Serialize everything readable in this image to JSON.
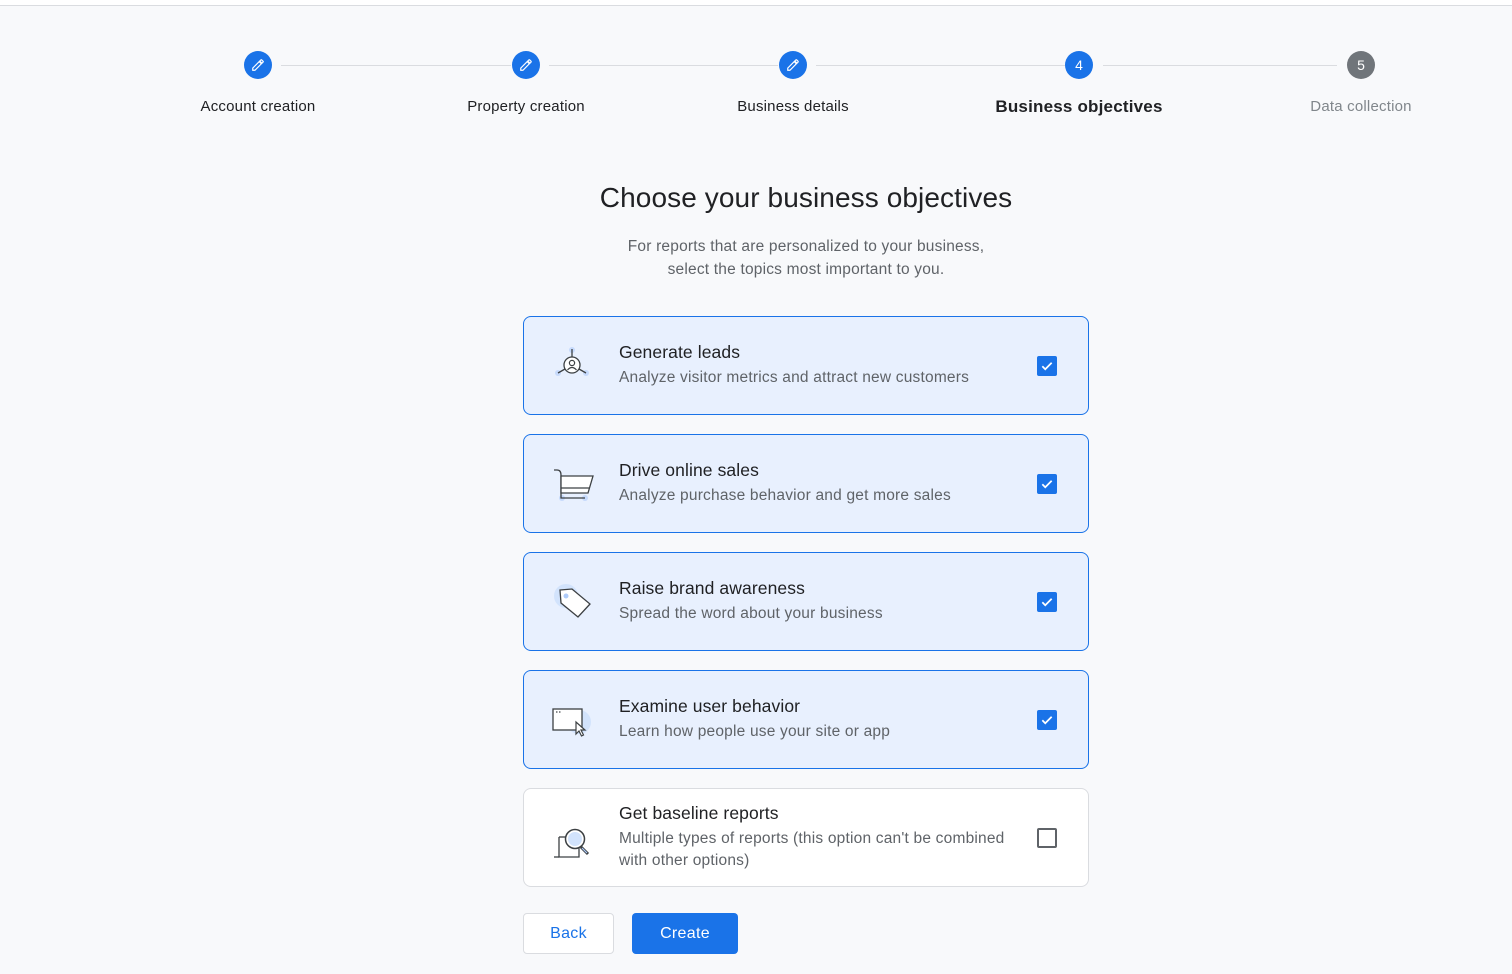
{
  "stepper": {
    "steps": [
      {
        "label": "Account creation",
        "state": "done",
        "icon": "pencil-icon"
      },
      {
        "label": "Property creation",
        "state": "done",
        "icon": "pencil-icon"
      },
      {
        "label": "Business details",
        "state": "done",
        "icon": "pencil-icon"
      },
      {
        "label": "Business objectives",
        "state": "active",
        "number": "4"
      },
      {
        "label": "Data collection",
        "state": "pending",
        "number": "5"
      }
    ]
  },
  "header": {
    "title": "Choose your business objectives",
    "subtitle_line1": "For reports that are personalized to your business,",
    "subtitle_line2": "select the topics most important to you."
  },
  "objectives": [
    {
      "title": "Generate leads",
      "description": "Analyze visitor metrics and attract new customers",
      "checked": true,
      "icon": "leads-target-icon"
    },
    {
      "title": "Drive online sales",
      "description": "Analyze purchase behavior and get more sales",
      "checked": true,
      "icon": "shopping-cart-icon"
    },
    {
      "title": "Raise brand awareness",
      "description": "Spread the word about your business",
      "checked": true,
      "icon": "price-tag-icon"
    },
    {
      "title": "Examine user behavior",
      "description": "Learn how people use your site or app",
      "checked": true,
      "icon": "browser-cursor-icon"
    },
    {
      "title": "Get baseline reports",
      "description": "Multiple types of reports (this option can't be combined with other options)",
      "checked": false,
      "icon": "report-magnifier-icon"
    }
  ],
  "actions": {
    "back_label": "Back",
    "create_label": "Create"
  },
  "colors": {
    "accent": "#1a73e8",
    "selected_bg": "#e8f0fe",
    "pending_step": "#70757a"
  }
}
